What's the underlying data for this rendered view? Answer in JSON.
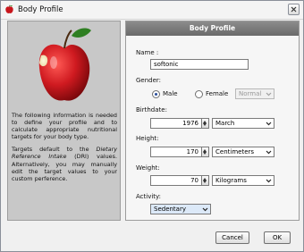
{
  "window": {
    "title": "Body Profile"
  },
  "icons": {
    "app": "apple-icon",
    "close": "close-icon",
    "image": "apple-image",
    "dropdown": "chevron-down-icon",
    "spin_up": "arrow-up-icon",
    "spin_down": "arrow-down-icon"
  },
  "left_panel": {
    "paragraph1": "The following information is needed to define your profile and to calculate appropriate nutritional targets for your body type.",
    "paragraph2_prefix": "Targets default to the ",
    "paragraph2_em": "Dietary Reference Intake",
    "paragraph2_suffix": " (DRI) values. Alternatively, you may manually edit the target values to your custom perference."
  },
  "form": {
    "header": "Body Profile",
    "name_label": "Name :",
    "name_value": "softonic",
    "gender_label": "Gender:",
    "gender_male": "Male",
    "gender_female": "Female",
    "gender_selected": "Male",
    "female_state": "Normal",
    "birthdate_label": "Birthdate:",
    "birth_year": "1976",
    "birth_month": "March",
    "height_label": "Height:",
    "height_value": "170",
    "height_unit": "Centimeters",
    "weight_label": "Weight:",
    "weight_value": "70",
    "weight_unit": "Kilograms",
    "activity_label": "Activity:",
    "activity_value": "Sedentary"
  },
  "buttons": {
    "cancel": "Cancel",
    "ok": "OK"
  },
  "colors": {
    "panel_header": "#7a7a7a",
    "left_panel_bg": "#c8c8c8",
    "apple_red": "#c8151b",
    "activity_highlight": "#dce9f8"
  }
}
